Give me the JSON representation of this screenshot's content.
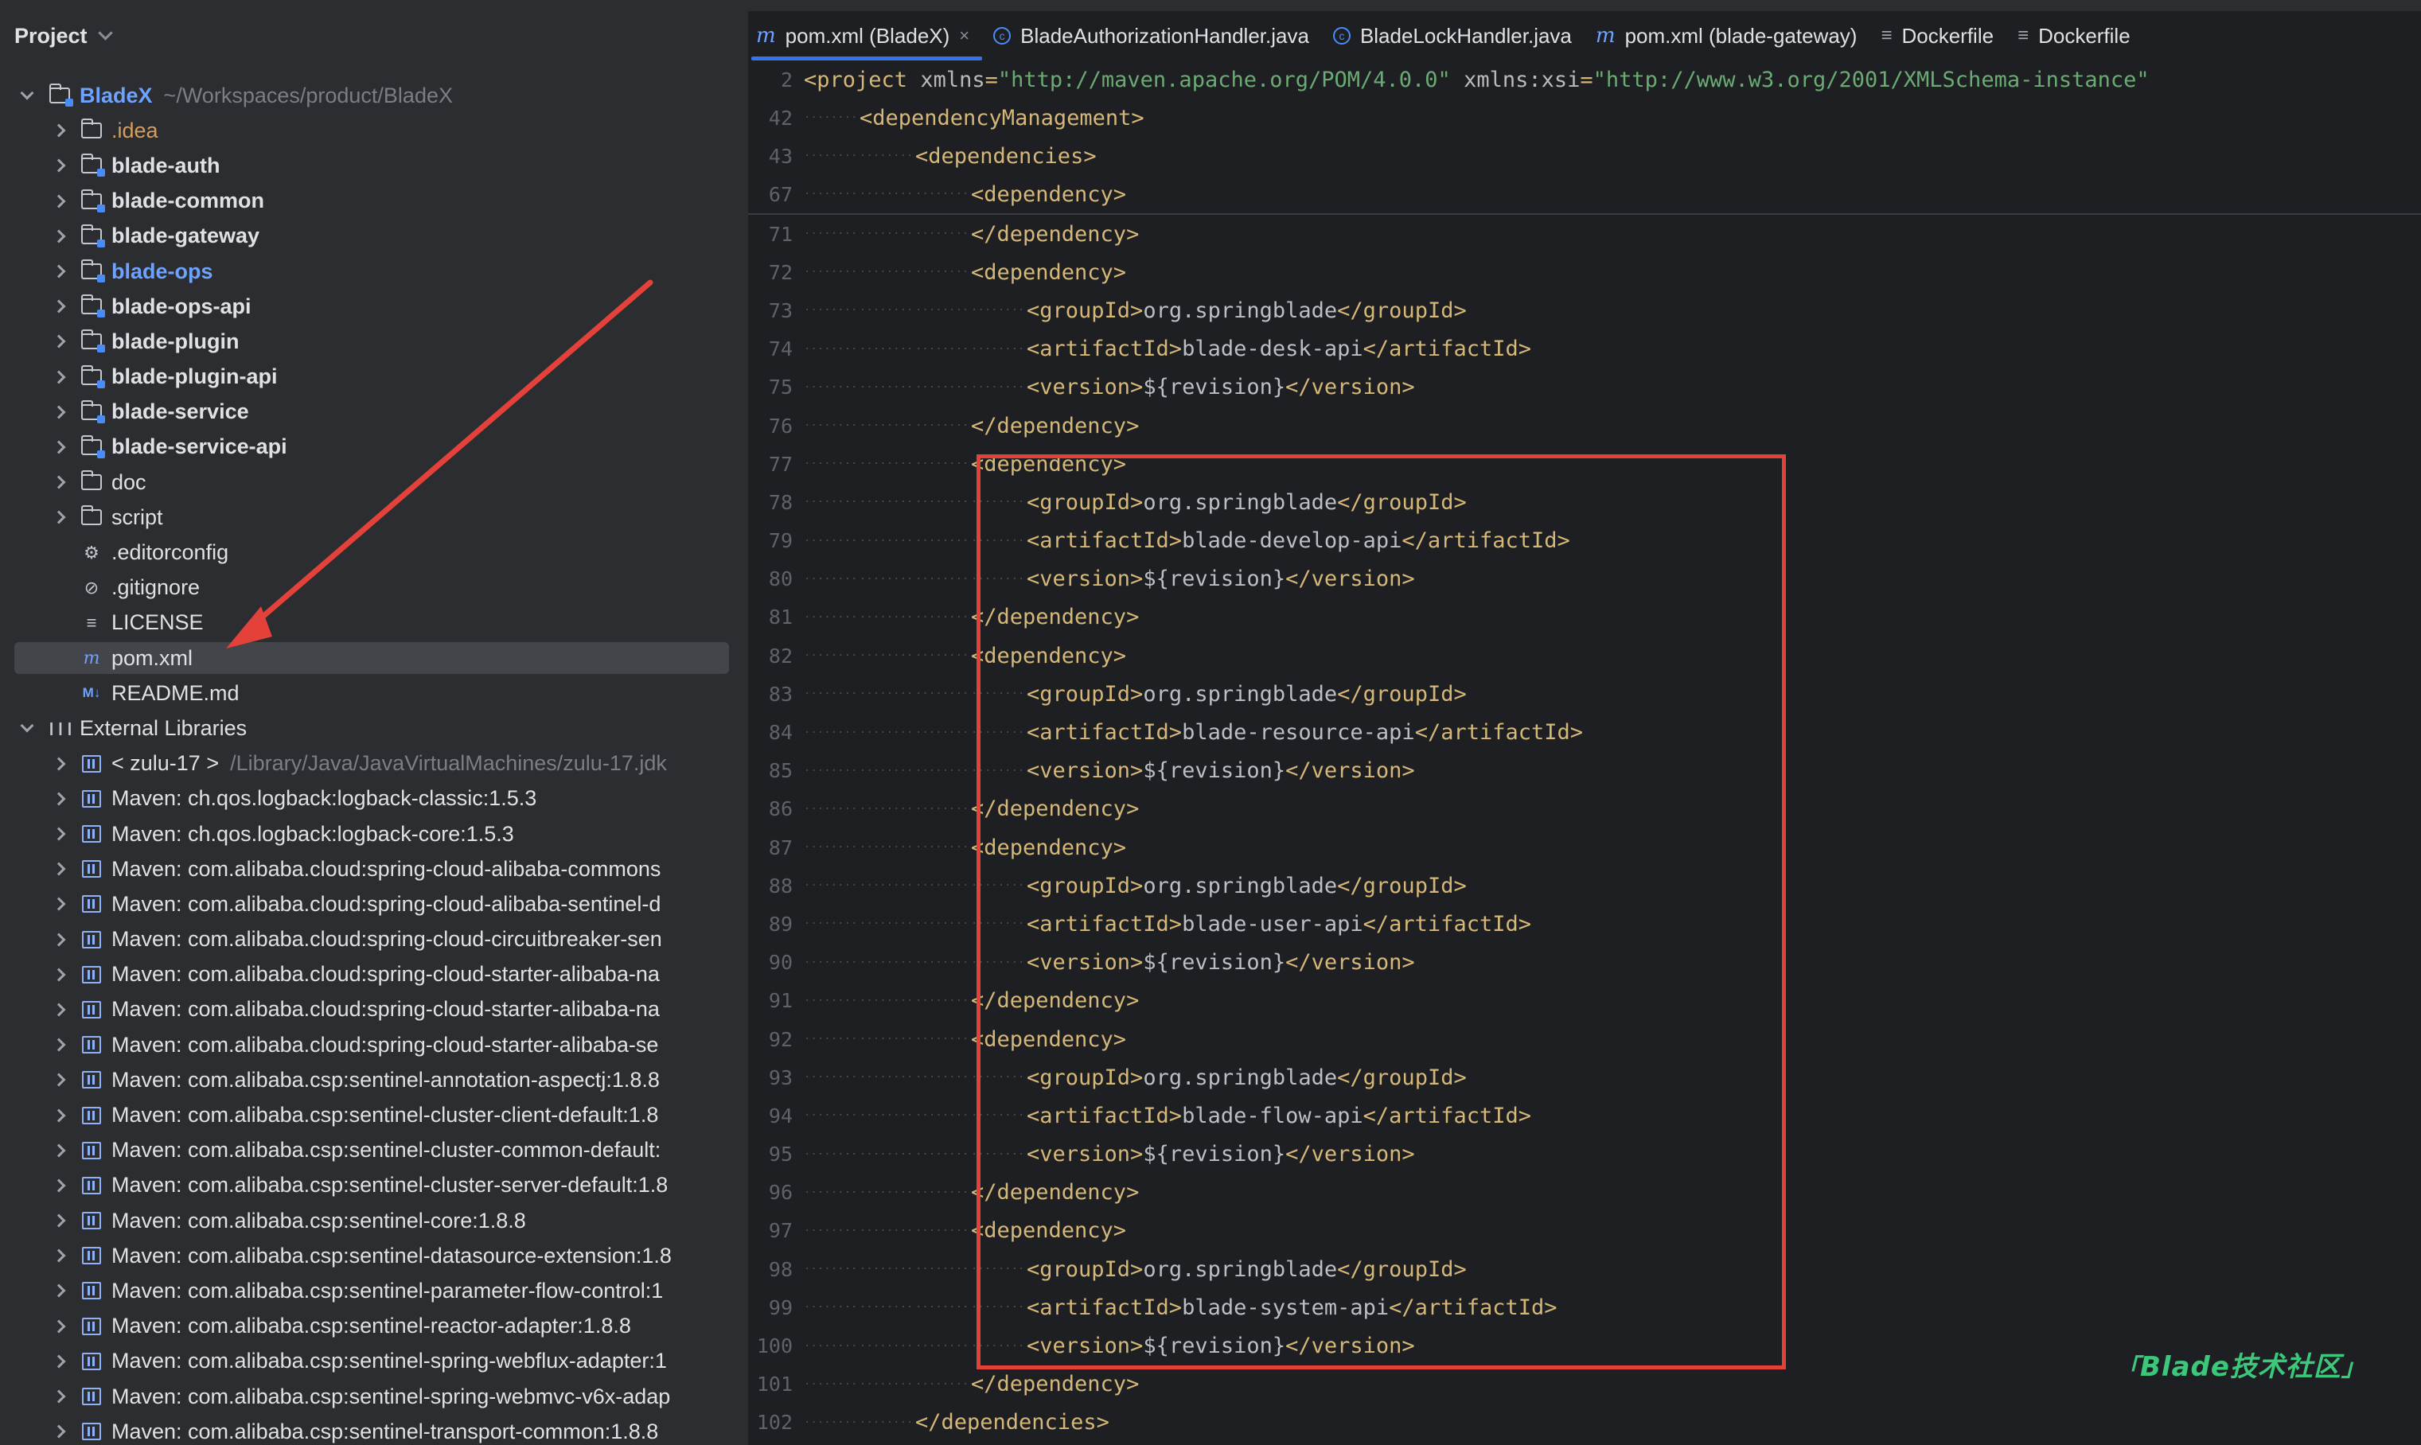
{
  "project_panel": {
    "title": "Project",
    "tree": [
      {
        "label": "BladeX",
        "hint": "~/Workspaces/product/BladeX",
        "icon": "module-folder-icon",
        "style": "blue",
        "arrow": "expanded",
        "depth": 0
      },
      {
        "label": ".idea",
        "icon": "folder-icon",
        "style": "orange",
        "arrow": "collapsed",
        "depth": 1
      },
      {
        "label": "blade-auth",
        "icon": "module-folder-icon",
        "style": "bold",
        "arrow": "collapsed",
        "depth": 1
      },
      {
        "label": "blade-common",
        "icon": "module-folder-icon",
        "style": "bold",
        "arrow": "collapsed",
        "depth": 1
      },
      {
        "label": "blade-gateway",
        "icon": "module-folder-icon",
        "style": "bold",
        "arrow": "collapsed",
        "depth": 1
      },
      {
        "label": "blade-ops",
        "icon": "module-folder-icon",
        "style": "blue",
        "arrow": "collapsed",
        "depth": 1
      },
      {
        "label": "blade-ops-api",
        "icon": "module-folder-icon",
        "style": "bold",
        "arrow": "collapsed",
        "depth": 1
      },
      {
        "label": "blade-plugin",
        "icon": "module-folder-icon",
        "style": "bold",
        "arrow": "collapsed",
        "depth": 1
      },
      {
        "label": "blade-plugin-api",
        "icon": "module-folder-icon",
        "style": "bold",
        "arrow": "collapsed",
        "depth": 1
      },
      {
        "label": "blade-service",
        "icon": "module-folder-icon",
        "style": "bold",
        "arrow": "collapsed",
        "depth": 1
      },
      {
        "label": "blade-service-api",
        "icon": "module-folder-icon",
        "style": "bold",
        "arrow": "collapsed",
        "depth": 1
      },
      {
        "label": "doc",
        "icon": "folder-icon",
        "style": "normal",
        "arrow": "collapsed",
        "depth": 1
      },
      {
        "label": "script",
        "icon": "folder-icon",
        "style": "normal",
        "arrow": "collapsed",
        "depth": 1
      },
      {
        "label": ".editorconfig",
        "icon": "gear-icon",
        "style": "normal",
        "arrow": "none",
        "depth": 1
      },
      {
        "label": ".gitignore",
        "icon": "ignore-icon",
        "style": "normal",
        "arrow": "none",
        "depth": 1
      },
      {
        "label": "LICENSE",
        "icon": "text-file-icon",
        "style": "normal",
        "arrow": "none",
        "depth": 1
      },
      {
        "label": "pom.xml",
        "icon": "maven-icon",
        "style": "normal",
        "arrow": "none",
        "depth": 1,
        "selected": true
      },
      {
        "label": "README.md",
        "icon": "markdown-icon",
        "style": "normal",
        "arrow": "none",
        "depth": 1
      },
      {
        "label": "External Libraries",
        "icon": "library-icon",
        "style": "normal",
        "arrow": "expanded",
        "depth": 0
      },
      {
        "label": "< zulu-17 >",
        "hint": "/Library/Java/JavaVirtualMachines/zulu-17.jdk",
        "icon": "jdk-icon",
        "style": "normal",
        "arrow": "collapsed",
        "depth": 1
      },
      {
        "label": "Maven: ch.qos.logback:logback-classic:1.5.3",
        "icon": "jar-icon",
        "style": "normal",
        "arrow": "collapsed",
        "depth": 1
      },
      {
        "label": "Maven: ch.qos.logback:logback-core:1.5.3",
        "icon": "jar-icon",
        "style": "normal",
        "arrow": "collapsed",
        "depth": 1
      },
      {
        "label": "Maven: com.alibaba.cloud:spring-cloud-alibaba-commons",
        "icon": "jar-icon",
        "style": "normal",
        "arrow": "collapsed",
        "depth": 1
      },
      {
        "label": "Maven: com.alibaba.cloud:spring-cloud-alibaba-sentinel-d",
        "icon": "jar-icon",
        "style": "normal",
        "arrow": "collapsed",
        "depth": 1
      },
      {
        "label": "Maven: com.alibaba.cloud:spring-cloud-circuitbreaker-sen",
        "icon": "jar-icon",
        "style": "normal",
        "arrow": "collapsed",
        "depth": 1
      },
      {
        "label": "Maven: com.alibaba.cloud:spring-cloud-starter-alibaba-na",
        "icon": "jar-icon",
        "style": "normal",
        "arrow": "collapsed",
        "depth": 1
      },
      {
        "label": "Maven: com.alibaba.cloud:spring-cloud-starter-alibaba-na",
        "icon": "jar-icon",
        "style": "normal",
        "arrow": "collapsed",
        "depth": 1
      },
      {
        "label": "Maven: com.alibaba.cloud:spring-cloud-starter-alibaba-se",
        "icon": "jar-icon",
        "style": "normal",
        "arrow": "collapsed",
        "depth": 1
      },
      {
        "label": "Maven: com.alibaba.csp:sentinel-annotation-aspectj:1.8.8",
        "icon": "jar-icon",
        "style": "normal",
        "arrow": "collapsed",
        "depth": 1
      },
      {
        "label": "Maven: com.alibaba.csp:sentinel-cluster-client-default:1.8",
        "icon": "jar-icon",
        "style": "normal",
        "arrow": "collapsed",
        "depth": 1
      },
      {
        "label": "Maven: com.alibaba.csp:sentinel-cluster-common-default:",
        "icon": "jar-icon",
        "style": "normal",
        "arrow": "collapsed",
        "depth": 1
      },
      {
        "label": "Maven: com.alibaba.csp:sentinel-cluster-server-default:1.8",
        "icon": "jar-icon",
        "style": "normal",
        "arrow": "collapsed",
        "depth": 1
      },
      {
        "label": "Maven: com.alibaba.csp:sentinel-core:1.8.8",
        "icon": "jar-icon",
        "style": "normal",
        "arrow": "collapsed",
        "depth": 1
      },
      {
        "label": "Maven: com.alibaba.csp:sentinel-datasource-extension:1.8",
        "icon": "jar-icon",
        "style": "normal",
        "arrow": "collapsed",
        "depth": 1
      },
      {
        "label": "Maven: com.alibaba.csp:sentinel-parameter-flow-control:1",
        "icon": "jar-icon",
        "style": "normal",
        "arrow": "collapsed",
        "depth": 1
      },
      {
        "label": "Maven: com.alibaba.csp:sentinel-reactor-adapter:1.8.8",
        "icon": "jar-icon",
        "style": "normal",
        "arrow": "collapsed",
        "depth": 1
      },
      {
        "label": "Maven: com.alibaba.csp:sentinel-spring-webflux-adapter:1",
        "icon": "jar-icon",
        "style": "normal",
        "arrow": "collapsed",
        "depth": 1
      },
      {
        "label": "Maven: com.alibaba.csp:sentinel-spring-webmvc-v6x-adap",
        "icon": "jar-icon",
        "style": "normal",
        "arrow": "collapsed",
        "depth": 1
      },
      {
        "label": "Maven: com.alibaba.csp:sentinel-transport-common:1.8.8",
        "icon": "jar-icon",
        "style": "normal",
        "arrow": "collapsed",
        "depth": 1
      }
    ]
  },
  "editor": {
    "tabs": [
      {
        "label": "pom.xml (BladeX)",
        "icon": "maven-icon",
        "active": true,
        "closable": true
      },
      {
        "label": "BladeAuthorizationHandler.java",
        "icon": "java-class-icon",
        "active": false
      },
      {
        "label": "BladeLockHandler.java",
        "icon": "java-class-icon",
        "active": false
      },
      {
        "label": "pom.xml (blade-gateway)",
        "icon": "maven-icon",
        "active": false
      },
      {
        "label": "Dockerfile",
        "icon": "dockerfile-icon",
        "active": false
      },
      {
        "label": "Dockerfile",
        "icon": "dockerfile-icon",
        "active": false
      }
    ],
    "sticky_lines": [
      {
        "n": "2",
        "indent": 0,
        "parts": [
          [
            "tag",
            "<project "
          ],
          [
            "attr",
            "xmlns"
          ],
          [
            "tag",
            "="
          ],
          [
            "str",
            "\"http://maven.apache.org/POM/4.0.0\""
          ],
          [
            "tag",
            " "
          ],
          [
            "attr",
            "xmlns:xsi"
          ],
          [
            "tag",
            "="
          ],
          [
            "str",
            "\"http://www.w3.org/2001/XMLSchema-instance\""
          ]
        ]
      },
      {
        "n": "42",
        "indent": 1,
        "parts": [
          [
            "tag",
            "<dependencyManagement>"
          ]
        ]
      },
      {
        "n": "43",
        "indent": 2,
        "parts": [
          [
            "tag",
            "<dependencies>"
          ]
        ]
      },
      {
        "n": "67",
        "indent": 3,
        "parts": [
          [
            "tag",
            "<dependency>"
          ]
        ]
      }
    ],
    "lines": [
      {
        "n": "71",
        "indent": 3,
        "parts": [
          [
            "tag",
            "</dependency>"
          ]
        ]
      },
      {
        "n": "72",
        "indent": 3,
        "parts": [
          [
            "tag",
            "<dependency>"
          ]
        ]
      },
      {
        "n": "73",
        "indent": 4,
        "parts": [
          [
            "tag",
            "<groupId>"
          ],
          [
            "txt",
            "org.springblade"
          ],
          [
            "tag",
            "</groupId>"
          ]
        ]
      },
      {
        "n": "74",
        "indent": 4,
        "parts": [
          [
            "tag",
            "<artifactId>"
          ],
          [
            "txt",
            "blade-desk-api"
          ],
          [
            "tag",
            "</artifactId>"
          ]
        ]
      },
      {
        "n": "75",
        "indent": 4,
        "parts": [
          [
            "tag",
            "<version>"
          ],
          [
            "txt",
            "${revision}"
          ],
          [
            "tag",
            "</version>"
          ]
        ]
      },
      {
        "n": "76",
        "indent": 3,
        "parts": [
          [
            "tag",
            "</dependency>"
          ]
        ]
      },
      {
        "n": "77",
        "indent": 3,
        "parts": [
          [
            "tag",
            "<dependency>"
          ]
        ]
      },
      {
        "n": "78",
        "indent": 4,
        "parts": [
          [
            "tag",
            "<groupId>"
          ],
          [
            "txt",
            "org.springblade"
          ],
          [
            "tag",
            "</groupId>"
          ]
        ]
      },
      {
        "n": "79",
        "indent": 4,
        "parts": [
          [
            "tag",
            "<artifactId>"
          ],
          [
            "txt",
            "blade-develop-api"
          ],
          [
            "tag",
            "</artifactId>"
          ]
        ]
      },
      {
        "n": "80",
        "indent": 4,
        "parts": [
          [
            "tag",
            "<version>"
          ],
          [
            "txt",
            "${revision}"
          ],
          [
            "tag",
            "</version>"
          ]
        ]
      },
      {
        "n": "81",
        "indent": 3,
        "parts": [
          [
            "tag",
            "</dependency>"
          ]
        ]
      },
      {
        "n": "82",
        "indent": 3,
        "parts": [
          [
            "tag",
            "<dependency>"
          ]
        ]
      },
      {
        "n": "83",
        "indent": 4,
        "parts": [
          [
            "tag",
            "<groupId>"
          ],
          [
            "txt",
            "org.springblade"
          ],
          [
            "tag",
            "</groupId>"
          ]
        ]
      },
      {
        "n": "84",
        "indent": 4,
        "parts": [
          [
            "tag",
            "<artifactId>"
          ],
          [
            "txt",
            "blade-resource-api"
          ],
          [
            "tag",
            "</artifactId>"
          ]
        ]
      },
      {
        "n": "85",
        "indent": 4,
        "parts": [
          [
            "tag",
            "<version>"
          ],
          [
            "txt",
            "${revision}"
          ],
          [
            "tag",
            "</version>"
          ]
        ]
      },
      {
        "n": "86",
        "indent": 3,
        "parts": [
          [
            "tag",
            "</dependency>"
          ]
        ]
      },
      {
        "n": "87",
        "indent": 3,
        "parts": [
          [
            "tag",
            "<dependency>"
          ]
        ]
      },
      {
        "n": "88",
        "indent": 4,
        "parts": [
          [
            "tag",
            "<groupId>"
          ],
          [
            "txt",
            "org.springblade"
          ],
          [
            "tag",
            "</groupId>"
          ]
        ]
      },
      {
        "n": "89",
        "indent": 4,
        "parts": [
          [
            "tag",
            "<artifactId>"
          ],
          [
            "txt",
            "blade-user-api"
          ],
          [
            "tag",
            "</artifactId>"
          ]
        ]
      },
      {
        "n": "90",
        "indent": 4,
        "parts": [
          [
            "tag",
            "<version>"
          ],
          [
            "txt",
            "${revision}"
          ],
          [
            "tag",
            "</version>"
          ]
        ]
      },
      {
        "n": "91",
        "indent": 3,
        "parts": [
          [
            "tag",
            "</dependency>"
          ]
        ]
      },
      {
        "n": "92",
        "indent": 3,
        "parts": [
          [
            "tag",
            "<dependency>"
          ]
        ]
      },
      {
        "n": "93",
        "indent": 4,
        "parts": [
          [
            "tag",
            "<groupId>"
          ],
          [
            "txt",
            "org.springblade"
          ],
          [
            "tag",
            "</groupId>"
          ]
        ]
      },
      {
        "n": "94",
        "indent": 4,
        "parts": [
          [
            "tag",
            "<artifactId>"
          ],
          [
            "txt",
            "blade-flow-api"
          ],
          [
            "tag",
            "</artifactId>"
          ]
        ]
      },
      {
        "n": "95",
        "indent": 4,
        "parts": [
          [
            "tag",
            "<version>"
          ],
          [
            "txt",
            "${revision}"
          ],
          [
            "tag",
            "</version>"
          ]
        ]
      },
      {
        "n": "96",
        "indent": 3,
        "parts": [
          [
            "tag",
            "</dependency>"
          ]
        ]
      },
      {
        "n": "97",
        "indent": 3,
        "parts": [
          [
            "tag",
            "<dependency>"
          ]
        ]
      },
      {
        "n": "98",
        "indent": 4,
        "parts": [
          [
            "tag",
            "<groupId>"
          ],
          [
            "txt",
            "org.springblade"
          ],
          [
            "tag",
            "</groupId>"
          ]
        ]
      },
      {
        "n": "99",
        "indent": 4,
        "parts": [
          [
            "tag",
            "<artifactId>"
          ],
          [
            "txt",
            "blade-system-api"
          ],
          [
            "tag",
            "</artifactId>"
          ]
        ]
      },
      {
        "n": "100",
        "indent": 4,
        "parts": [
          [
            "tag",
            "<version>"
          ],
          [
            "txt",
            "${revision}"
          ],
          [
            "tag",
            "</version>"
          ]
        ]
      },
      {
        "n": "101",
        "indent": 3,
        "parts": [
          [
            "tag",
            "</dependency>"
          ]
        ]
      },
      {
        "n": "102",
        "indent": 2,
        "parts": [
          [
            "tag",
            "</dependencies>"
          ]
        ]
      }
    ]
  },
  "annotations": {
    "highlight_color": "#e5413b",
    "arrow_color": "#e5413b"
  },
  "watermark": {
    "text": "Blade技术社区"
  },
  "colors": {
    "background": "#1e1f22",
    "panel": "#2b2d30",
    "tag": "#d5b778",
    "string": "#6aab73",
    "accent": "#3574f0"
  }
}
